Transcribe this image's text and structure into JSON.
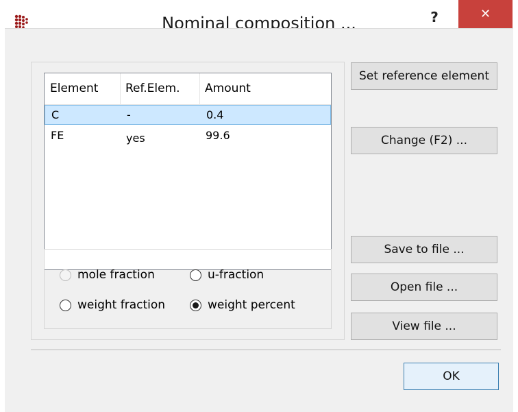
{
  "window": {
    "title": "Nominal composition ...",
    "help_label": "?",
    "close_label": "✕",
    "icon": "app-dots-icon",
    "close_color": "#c8413c"
  },
  "table": {
    "columns": [
      "Element",
      "Ref.Elem.",
      "Amount"
    ],
    "rows": [
      {
        "element": "C",
        "ref": "-",
        "amount": "0.4",
        "selected": true
      },
      {
        "element": "FE",
        "ref": "yes",
        "amount": "99.6",
        "selected": false
      }
    ],
    "selection_color": "#cde8ff"
  },
  "units": {
    "options": [
      {
        "label": "mole fraction",
        "checked": false,
        "enabled": false
      },
      {
        "label": "u-fraction",
        "checked": false,
        "enabled": true
      },
      {
        "label": "weight fraction",
        "checked": false,
        "enabled": true
      },
      {
        "label": "weight percent",
        "checked": true,
        "enabled": true
      }
    ]
  },
  "buttons": {
    "set_reference": "Set reference element",
    "change": "Change (F2) ...",
    "save": "Save to file ...",
    "open": "Open file ...",
    "view": "View file ...",
    "ok": "OK"
  }
}
